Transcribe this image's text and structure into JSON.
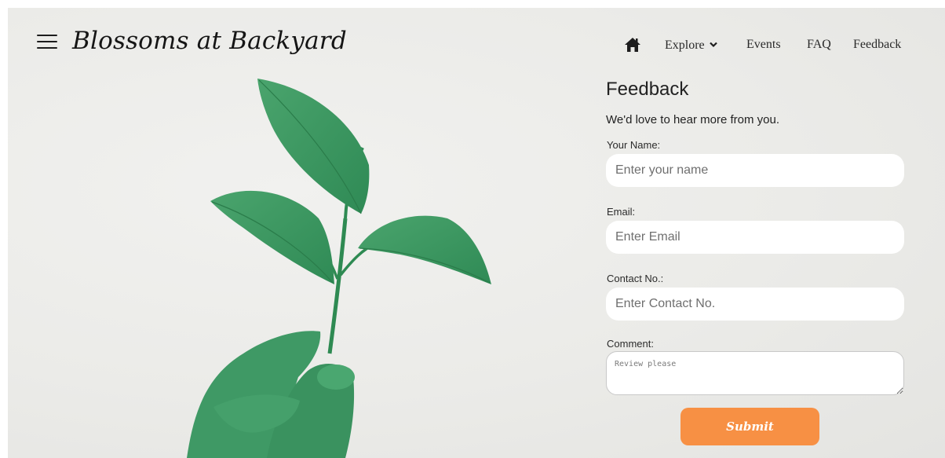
{
  "header": {
    "brand": "Blossoms at Backyard",
    "menu_icon": "hamburger-menu-icon"
  },
  "nav": {
    "home_icon": "home-icon",
    "items": [
      {
        "label": "Explore",
        "icon": "chevron-down-icon"
      },
      {
        "label": "Events"
      },
      {
        "label": "FAQ"
      },
      {
        "label": "Feedback"
      }
    ]
  },
  "hero": {
    "image": "green-plant-in-hand"
  },
  "form": {
    "title": "Feedback",
    "subtitle": "We'd love to hear more from you.",
    "name_label": "Your Name:",
    "name_placeholder": "Enter your name",
    "email_label": "Email:",
    "email_placeholder": "Enter Email",
    "contact_label": "Contact No.:",
    "contact_placeholder": "Enter Contact No.",
    "comment_label": "Comment:",
    "comment_placeholder": "Review please",
    "submit_label": "Submit"
  },
  "colors": {
    "background": "#ebebe8",
    "leaf": "#3e9a62",
    "accent": "#f79044"
  }
}
